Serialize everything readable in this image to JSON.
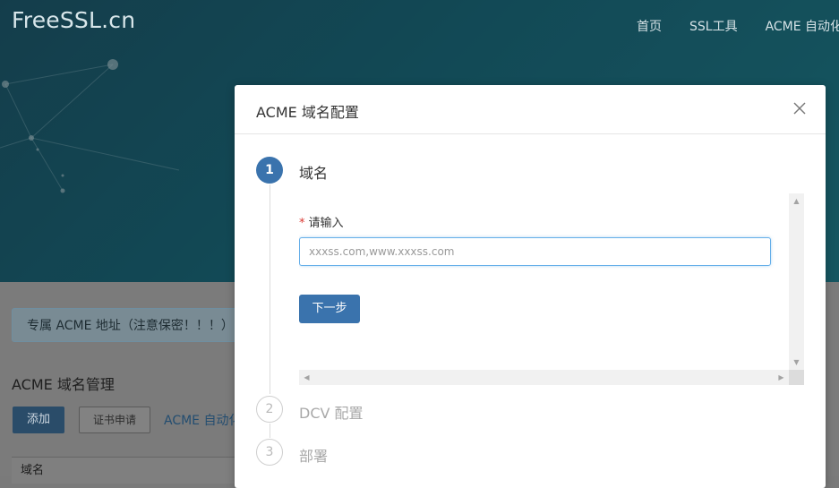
{
  "site": {
    "logo": "FreeSSL.cn",
    "nav": [
      "首页",
      "SSL工具",
      "ACME 自动化"
    ]
  },
  "background": {
    "acme_address_notice": "专属 ACME 地址（注意保密！！！）",
    "section_title": "ACME 域名管理",
    "add_button": "添加",
    "cert_apply_button": "证书申请",
    "acme_auto_link": "ACME 自动化",
    "table_header_domain": "域名"
  },
  "modal": {
    "title": "ACME 域名配置",
    "steps": [
      {
        "number": "1",
        "label": "域名",
        "state": "active"
      },
      {
        "number": "2",
        "label": "DCV 配置",
        "state": "pending"
      },
      {
        "number": "3",
        "label": "部署",
        "state": "pending"
      }
    ],
    "form": {
      "required_mark": "*",
      "label": "请输入",
      "input_value": "",
      "input_placeholder": "xxxss.com,www.xxxss.com",
      "next_button": "下一步"
    }
  },
  "colors": {
    "primary": "#3a73ad",
    "hero": "#1d7184",
    "required": "#d9352f"
  }
}
